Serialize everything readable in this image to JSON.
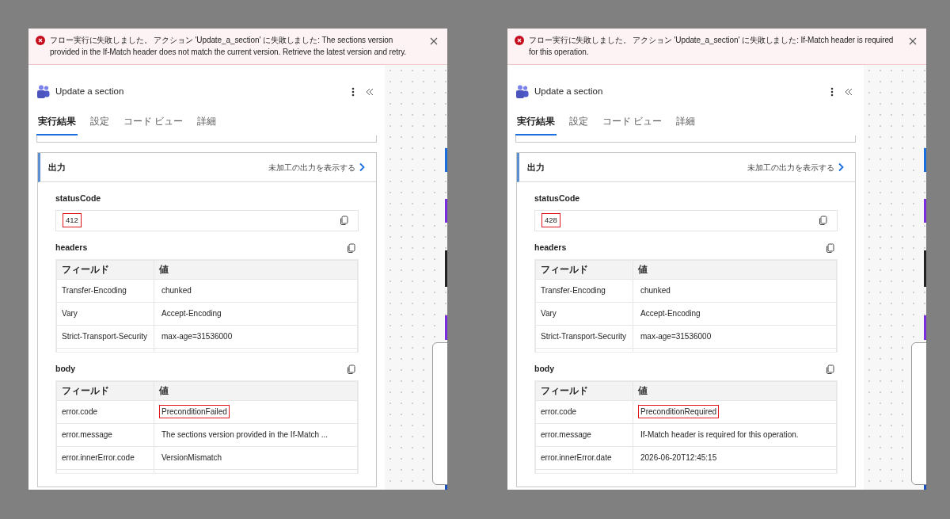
{
  "screenshots": [
    {
      "banner": {
        "message": "フロー実行に失敗しました。 アクション 'Update_a_section' に失敗しました: The sections version provided in the If-Match header does not match the current version. Retrieve the latest version and retry."
      },
      "action": {
        "title": "Update a section"
      },
      "tabs": [
        {
          "label": "実行結果",
          "selected": true
        },
        {
          "label": "設定",
          "selected": false
        },
        {
          "label": "コード ビュー",
          "selected": false
        },
        {
          "label": "詳細",
          "selected": false
        }
      ],
      "output": {
        "title": "出力",
        "raw_link": "未加工の出力を表示する"
      },
      "status_code": {
        "label": "statusCode",
        "value": "412",
        "highlighted": true
      },
      "headers": {
        "label": "headers",
        "columns": [
          "フィールド",
          "値"
        ],
        "rows": [
          {
            "field": "Transfer-Encoding",
            "value": "chunked",
            "highlighted": false
          },
          {
            "field": "Vary",
            "value": "Accept-Encoding",
            "highlighted": false
          },
          {
            "field": "Strict-Transport-Security",
            "value": "max-age=31536000",
            "highlighted": false
          }
        ]
      },
      "body": {
        "label": "body",
        "columns": [
          "フィールド",
          "値"
        ],
        "rows": [
          {
            "field": "error.code",
            "value": "PreconditionFailed",
            "highlighted": true
          },
          {
            "field": "error.message",
            "value": "The sections version provided in the If-Match ...",
            "highlighted": false
          },
          {
            "field": "error.innerError.code",
            "value": "VersionMismatch",
            "highlighted": false
          }
        ]
      }
    },
    {
      "banner": {
        "message": "フロー実行に失敗しました。 アクション 'Update_a_section' に失敗しました: If-Match header is required for this operation."
      },
      "action": {
        "title": "Update a section"
      },
      "tabs": [
        {
          "label": "実行結果",
          "selected": true
        },
        {
          "label": "設定",
          "selected": false
        },
        {
          "label": "コード ビュー",
          "selected": false
        },
        {
          "label": "詳細",
          "selected": false
        }
      ],
      "output": {
        "title": "出力",
        "raw_link": "未加工の出力を表示する"
      },
      "status_code": {
        "label": "statusCode",
        "value": "428",
        "highlighted": true
      },
      "headers": {
        "label": "headers",
        "columns": [
          "フィールド",
          "値"
        ],
        "rows": [
          {
            "field": "Transfer-Encoding",
            "value": "chunked",
            "highlighted": false
          },
          {
            "field": "Vary",
            "value": "Accept-Encoding",
            "highlighted": false
          },
          {
            "field": "Strict-Transport-Security",
            "value": "max-age=31536000",
            "highlighted": false
          }
        ]
      },
      "body": {
        "label": "body",
        "columns": [
          "フィールド",
          "値"
        ],
        "rows": [
          {
            "field": "error.code",
            "value": "PreconditionRequired",
            "highlighted": true
          },
          {
            "field": "error.message",
            "value": "If-Match header is required for this operation.",
            "highlighted": false
          },
          {
            "field": "error.innerError.date",
            "value": "2026-06-20T12:45:15",
            "highlighted": false
          }
        ]
      }
    }
  ]
}
